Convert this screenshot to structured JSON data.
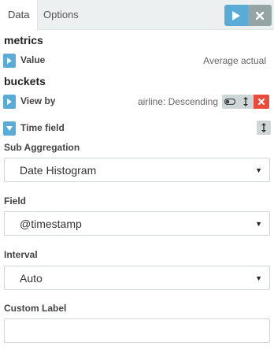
{
  "tabs": [
    {
      "label": "Data"
    },
    {
      "label": "Options"
    }
  ],
  "actions": {
    "apply_icon": "play-icon",
    "discard_icon": "close-icon"
  },
  "metrics": {
    "title": "metrics",
    "items": [
      {
        "label": "Value",
        "description": "Average actual"
      }
    ]
  },
  "buckets": {
    "title": "buckets",
    "items": [
      {
        "label": "View by",
        "description": "airline: Descending"
      },
      {
        "label": "Time field",
        "description": ""
      }
    ]
  },
  "form": {
    "sub_aggregation": {
      "label": "Sub Aggregation",
      "value": "Date Histogram"
    },
    "field": {
      "label": "Field",
      "value": "@timestamp"
    },
    "interval": {
      "label": "Interval",
      "value": "Auto"
    },
    "custom_label": {
      "label": "Custom Label",
      "value": ""
    }
  },
  "colors": {
    "accent": "#5aabd6",
    "danger": "#e74c3c",
    "muted": "#95a5a6"
  }
}
